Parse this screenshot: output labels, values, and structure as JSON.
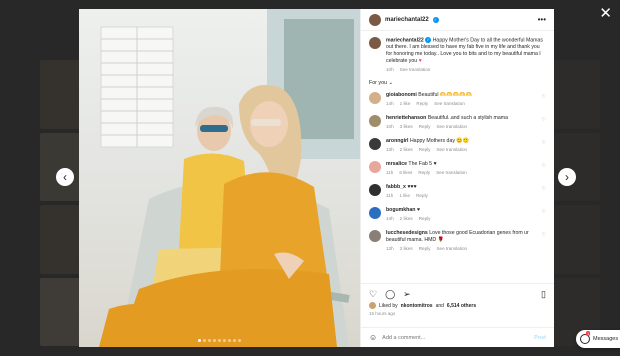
{
  "post": {
    "username": "mariechantal22",
    "caption": "Happy Mother's Day to all the wonderful Mamas out there. I am blessed to have my fab five in my life and thank you for honoring me today.. Love you to bits and to my beautiful mama I celebrate you",
    "caption_emoji": "♥",
    "caption_time": "10h",
    "see_translation": "See translation",
    "for_you": "For you",
    "carousel_count": 9,
    "carousel_active": 0
  },
  "comments": [
    {
      "user": "gioiabonomi",
      "text": "Beautiful 🫶🫶🫶🫶🫶",
      "time": "14h",
      "likes": "1 like",
      "reply": "Reply",
      "translate": "See translation",
      "avatar": "#d4b08a"
    },
    {
      "user": "henriettehanson",
      "text": "Beautiful..and such a stylish mama",
      "time": "10h",
      "likes": "3 likes",
      "reply": "Reply",
      "translate": "See translation",
      "avatar": "#a08d6b"
    },
    {
      "user": "aronngirl",
      "text": "Happy Mothers day 😊🙂",
      "time": "13h",
      "likes": "2 likes",
      "reply": "Reply",
      "translate": "See translation",
      "avatar": "#3a3a3a"
    },
    {
      "user": "mrsalice",
      "text": "The Fab 5 ♥",
      "time": "11h",
      "likes": "6 likes",
      "reply": "Reply",
      "translate": "See translation",
      "avatar": "#e8a79a"
    },
    {
      "user": "fabbb_x",
      "text": "♥♥♥",
      "time": "11h",
      "likes": "1 like",
      "reply": "Reply",
      "translate": "",
      "avatar": "#2f2f2f"
    },
    {
      "user": "bogumkhan",
      "text": "♥",
      "time": "14h",
      "likes": "2 likes",
      "reply": "Reply",
      "translate": "",
      "avatar": "#2a6fbf"
    },
    {
      "user": "lucchesedesigns",
      "text": "Love those good Ecuadorian genes from ur beautiful mama. HMD 🌹",
      "time": "13h",
      "likes": "3 likes",
      "reply": "Reply",
      "translate": "See translation",
      "avatar": "#8a7f77"
    }
  ],
  "footer": {
    "liked_by_prefix": "Liked by",
    "liked_by_user": "nkontomitros",
    "liked_by_join": "and",
    "liked_by_others": "6,514 others",
    "post_time": "15 hours ago",
    "comment_placeholder": "Add a comment...",
    "post_label": "Post"
  },
  "messages": {
    "label": "Messages",
    "badge": "1"
  },
  "colors": {
    "accent": "#0095f6",
    "heart": "#ed4956",
    "post_disabled": "#b2dffc"
  }
}
